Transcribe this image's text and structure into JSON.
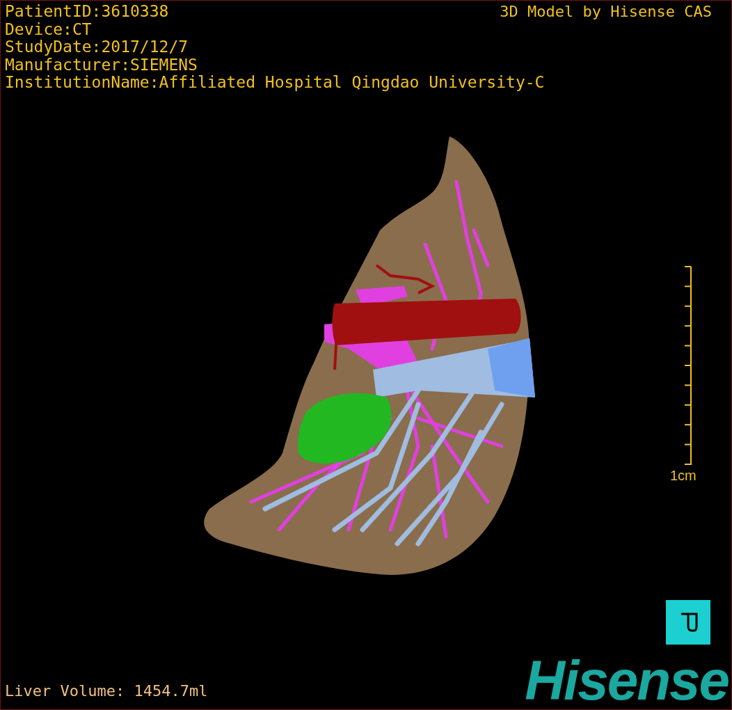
{
  "patient_info": [
    "PatientID:3610338",
    "Device:CT",
    "StudyDate:2017/12/7",
    "Manufacturer:SIEMENS",
    "InstitutionName:Affiliated Hospital Qingdao University-C"
  ],
  "title": "3D Model by Hisense CAS",
  "scale_bar": {
    "label": "1cm"
  },
  "liver_volume": "Liver Volume: 1454.7ml",
  "logo": "Hisense"
}
